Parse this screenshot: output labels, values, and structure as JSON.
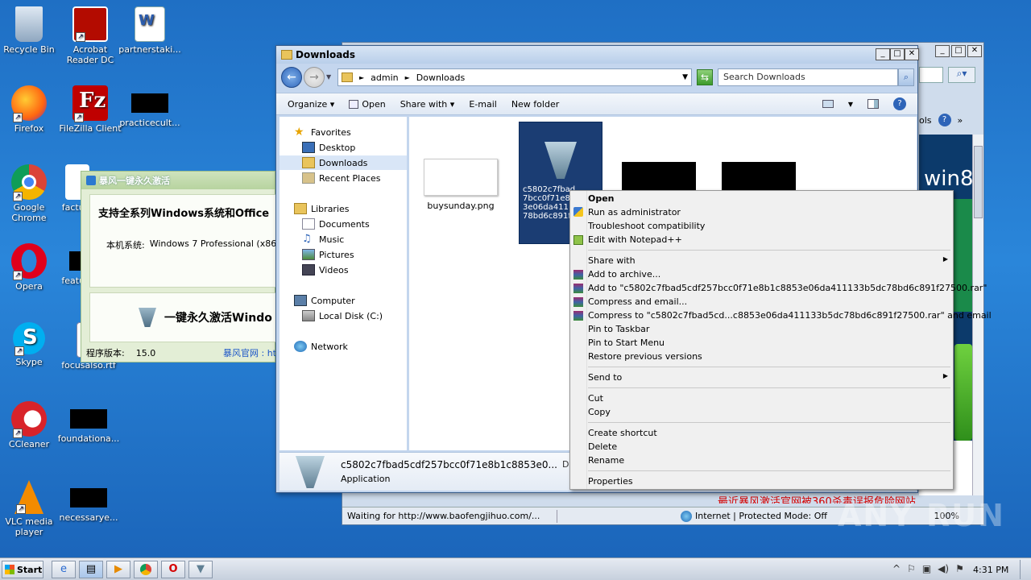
{
  "desktop": {
    "icons": [
      {
        "label": "Recycle Bin"
      },
      {
        "label": "Acrobat Reader DC"
      },
      {
        "label": "partnerstaki..."
      },
      {
        "label": "Firefox"
      },
      {
        "label": "FileZilla Client"
      },
      {
        "label": "practicecult..."
      },
      {
        "label": "Google Chrome"
      },
      {
        "label": "factu..."
      },
      {
        "label": "Opera"
      },
      {
        "label": "featu..."
      },
      {
        "label": "Skype"
      },
      {
        "label": "focusalso.rtf"
      },
      {
        "label": "CCleaner"
      },
      {
        "label": "foundationa..."
      },
      {
        "label": "VLC media player"
      },
      {
        "label": "necessarye..."
      }
    ]
  },
  "cn_app": {
    "title": "暴风一键永久激活",
    "headline": "支持全系列Windows系统和Office",
    "system_label": "本机系统:",
    "system_value": "Windows 7 Professional (x86)",
    "activate_label": "一键永久激活Windo",
    "version_label": "程序版本:",
    "version_value": "15.0",
    "site_label": "暴风官网 : ht"
  },
  "ie": {
    "status_text": "Waiting for http://www.baofengjihuo.com/...",
    "zone_text": "Internet | Protected Mode: Off",
    "zoom": "100%",
    "banner_text": "win8",
    "tools_label": "ols",
    "bottom_red_text": "最近暴风激活官网被360杀毒误报危险网站"
  },
  "explorer": {
    "title": "Downloads",
    "breadcrumb": [
      "admin",
      "Downloads"
    ],
    "search_placeholder": "Search Downloads",
    "toolbar": {
      "organize": "Organize",
      "open": "Open",
      "share_with": "Share with",
      "email": "E-mail",
      "new_folder": "New folder"
    },
    "nav": {
      "favorites": "Favorites",
      "desktop": "Desktop",
      "downloads": "Downloads",
      "recent": "Recent Places",
      "libraries": "Libraries",
      "documents": "Documents",
      "music": "Music",
      "pictures": "Pictures",
      "videos": "Videos",
      "computer": "Computer",
      "local_disk": "Local Disk (C:)",
      "network": "Network"
    },
    "files": [
      {
        "name": "buysunday.png"
      },
      {
        "name_lines": [
          "c5802c7fbad",
          "7bcc0f71e8",
          "3e06da411",
          "78bd6c891f2"
        ]
      }
    ],
    "details": {
      "filename": "c5802c7fbad5cdf257bcc0f71e8b1c8853e0...",
      "date_label": "Date m",
      "type": "Application"
    }
  },
  "context_menu": {
    "open": "Open",
    "run_admin": "Run as administrator",
    "troubleshoot": "Troubleshoot compatibility",
    "edit_npp": "Edit with Notepad++",
    "share_with": "Share with",
    "add_archive": "Add to archive...",
    "add_to_rar": "Add to \"c5802c7fbad5cdf257bcc0f71e8b1c8853e06da411133b5dc78bd6c891f27500.rar\"",
    "compress_email": "Compress and email...",
    "compress_rar_email": "Compress to \"c5802c7fbad5cd...c8853e06da411133b5dc78bd6c891f27500.rar\" and email",
    "pin_taskbar": "Pin to Taskbar",
    "pin_start": "Pin to Start Menu",
    "restore": "Restore previous versions",
    "send_to": "Send to",
    "cut": "Cut",
    "copy": "Copy",
    "create_shortcut": "Create shortcut",
    "delete": "Delete",
    "rename": "Rename",
    "properties": "Properties"
  },
  "taskbar": {
    "start": "Start",
    "clock": "4:31 PM"
  },
  "watermark": "ANY RUN"
}
